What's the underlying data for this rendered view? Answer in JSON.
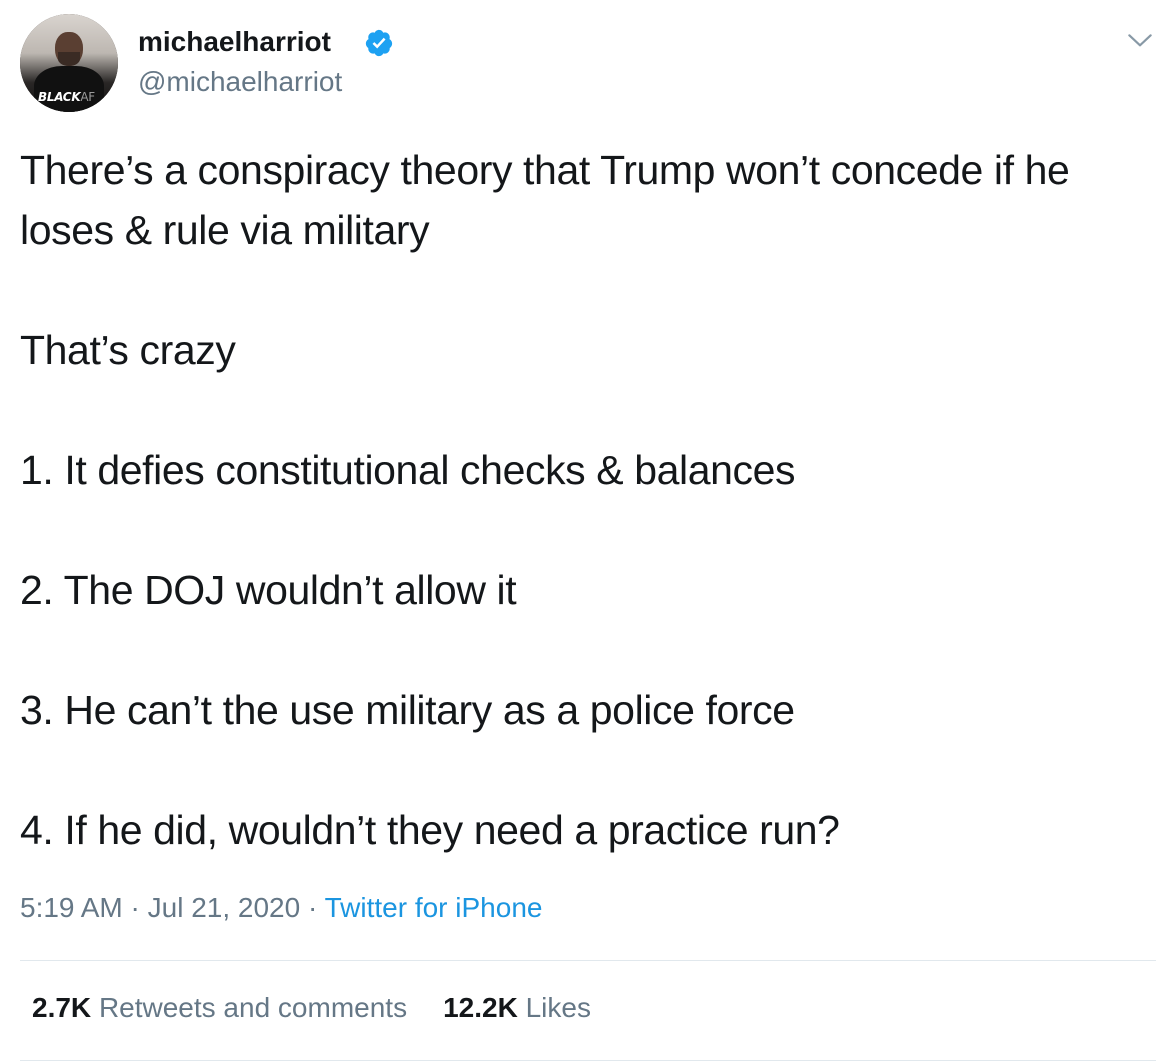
{
  "author": {
    "display_name": "michaelharriot",
    "handle": "@michaelharriot",
    "verified": true,
    "avatar_logo_primary": "BLACK",
    "avatar_logo_secondary": "AF"
  },
  "tweet": {
    "lines": [
      "There’s a conspiracy theory that Trump won’t concede if he loses & rule via military",
      "That’s crazy",
      "1. It defies constitutional checks & balances",
      "2. The DOJ wouldn’t allow it",
      "3. He can’t the use military as a police force",
      "4. If he did, wouldn’t they need a practice run?"
    ]
  },
  "meta": {
    "time": "5:19 AM",
    "separator": "·",
    "date": "Jul 21, 2020",
    "source": "Twitter for iPhone"
  },
  "stats": {
    "retweets_count": "2.7K",
    "retweets_label": "Retweets and comments",
    "likes_count": "12.2K",
    "likes_label": "Likes"
  },
  "icons": {
    "verified": "verified-badge-icon",
    "caret": "chevron-down-icon"
  },
  "colors": {
    "text": "#14171a",
    "secondary": "#657786",
    "link": "#1b95e0",
    "verified": "#1da1f2",
    "divider": "#e1e8ed"
  }
}
